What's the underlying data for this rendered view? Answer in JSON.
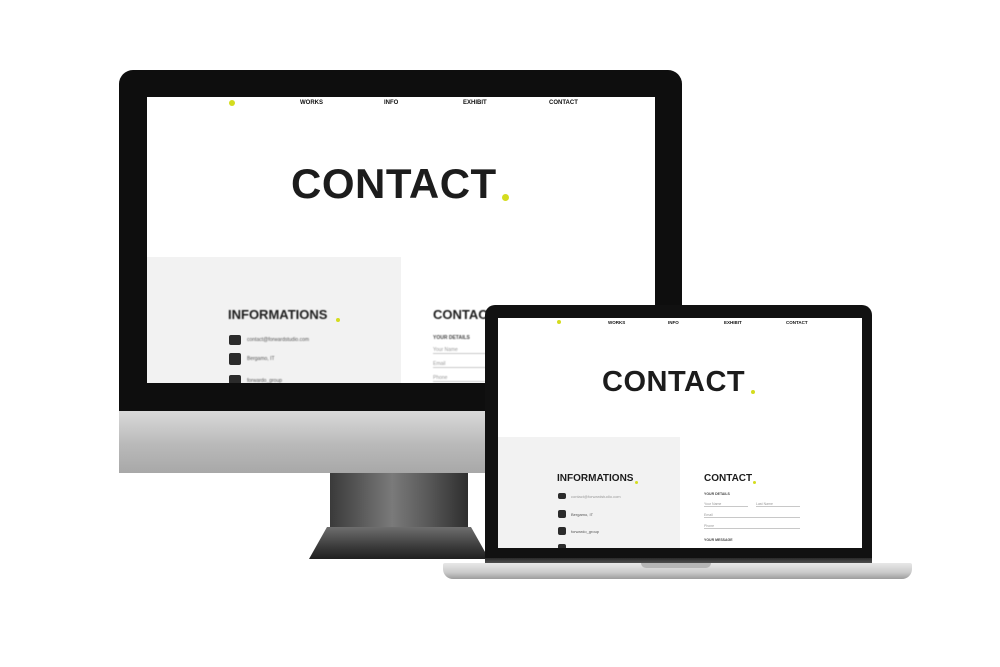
{
  "nav": {
    "items": [
      "WORKS",
      "INFO",
      "EXHIBIT",
      "CONTACT"
    ]
  },
  "hero": {
    "title": "CONTACT"
  },
  "info_section": {
    "title": "INFORMATIONS",
    "items": [
      {
        "icon": "mail-icon",
        "text": "contact@forwardstudio.com"
      },
      {
        "icon": "location-icon",
        "text": "Bergamo, IT"
      },
      {
        "icon": "phone-icon",
        "text": "forwardo_group"
      }
    ]
  },
  "contact_section": {
    "title": "CONTACT",
    "details_label": "YOUR DETAILS",
    "fields": {
      "name": "Your Name",
      "lastname": "Last Name",
      "email": "Email",
      "phone": "Phone"
    },
    "message_label": "YOUR MESSAGE"
  },
  "colors": {
    "accent": "#d4dc1e",
    "text_dark": "#1c1c1c",
    "panel_bg": "#f2f2f2"
  }
}
